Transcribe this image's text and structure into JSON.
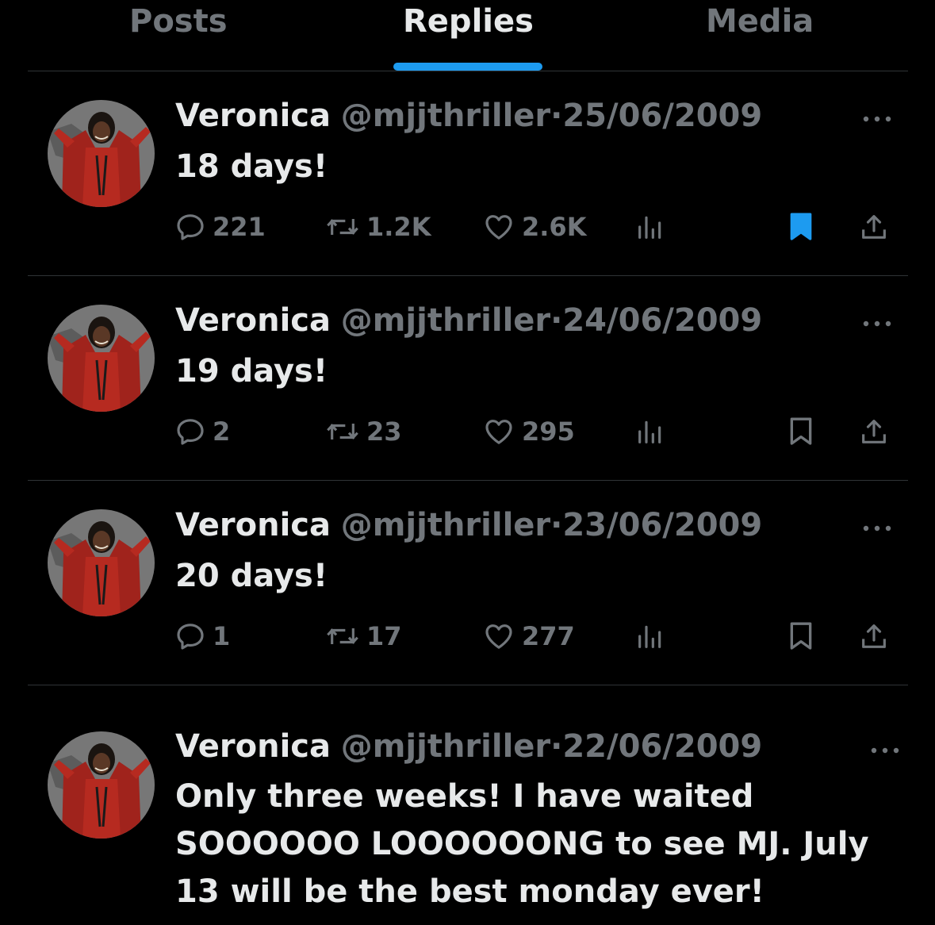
{
  "tabs": {
    "posts": "Posts",
    "replies": "Replies",
    "media": "Media",
    "active": "replies"
  },
  "colors": {
    "accent": "#1d9bf0",
    "background": "#000000",
    "text_primary": "#e7e9ea",
    "text_secondary": "#71767b",
    "divider": "#2f3336"
  },
  "tweets": [
    {
      "display_name": "Veronica",
      "handle": "@mjjthriller",
      "separator": "·",
      "date": "25/06/2009",
      "text": "18 days!",
      "replies": "221",
      "retweets": "1.2K",
      "likes": "2.6K",
      "bookmarked": true,
      "icons": [
        "reply-icon",
        "retweet-icon",
        "like-icon",
        "views-icon",
        "bookmark-icon",
        "share-icon",
        "more-icon"
      ]
    },
    {
      "display_name": "Veronica",
      "handle": "@mjjthriller",
      "separator": "·",
      "date": "24/06/2009",
      "text": "19 days!",
      "replies": "2",
      "retweets": "23",
      "likes": "295",
      "bookmarked": false,
      "icons": [
        "reply-icon",
        "retweet-icon",
        "like-icon",
        "views-icon",
        "bookmark-icon",
        "share-icon",
        "more-icon"
      ]
    },
    {
      "display_name": "Veronica",
      "handle": "@mjjthriller",
      "separator": "·",
      "date": "23/06/2009",
      "text": "20 days!",
      "replies": "1",
      "retweets": "17",
      "likes": "277",
      "bookmarked": false,
      "icons": [
        "reply-icon",
        "retweet-icon",
        "like-icon",
        "views-icon",
        "bookmark-icon",
        "share-icon",
        "more-icon"
      ]
    },
    {
      "display_name": "Veronica",
      "handle": "@mjjthriller",
      "separator": "·",
      "date": "22/06/2009",
      "text_lines": [
        "Only three weeks! I have waited",
        "SOOOOOO LOOOOOONG to see MJ. July",
        "13 will be the best monday ever!"
      ]
    }
  ]
}
